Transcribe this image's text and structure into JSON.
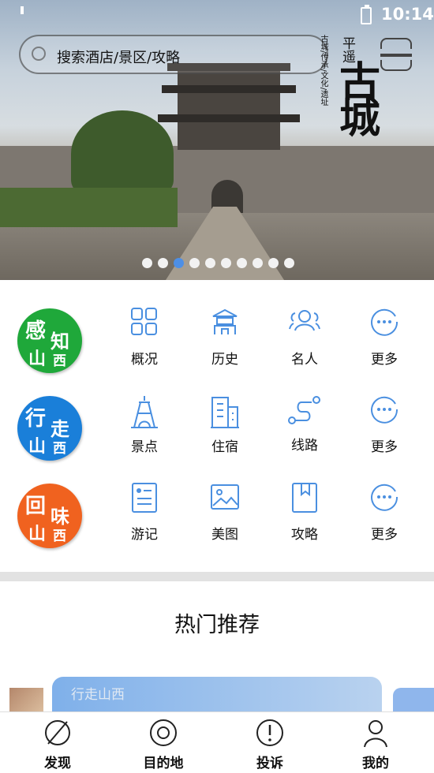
{
  "status_bar": {
    "time": "10:14"
  },
  "search": {
    "placeholder": "搜索酒店/景区/攻略"
  },
  "banner_logo": {
    "title": "平遥",
    "tagline": "古城/传承/文化/遗址",
    "big": "古城"
  },
  "carousel": {
    "count": 10,
    "active_index": 2
  },
  "categories": [
    {
      "badge": "感知山西",
      "badge_chars": [
        "感",
        "知",
        "山",
        "西"
      ],
      "badge_color": "#1fa83a",
      "items": [
        {
          "label": "概况",
          "icon": "grid-icon"
        },
        {
          "label": "历史",
          "icon": "pavilion-icon"
        },
        {
          "label": "名人",
          "icon": "people-icon"
        },
        {
          "label": "更多",
          "icon": "more-icon"
        }
      ]
    },
    {
      "badge": "行走山西",
      "badge_chars": [
        "行",
        "走",
        "山",
        "西"
      ],
      "badge_color": "#1a7fd9",
      "items": [
        {
          "label": "景点",
          "icon": "tower-icon"
        },
        {
          "label": "住宿",
          "icon": "building-icon"
        },
        {
          "label": "线路",
          "icon": "route-icon"
        },
        {
          "label": "更多",
          "icon": "more-icon"
        }
      ]
    },
    {
      "badge": "回味山西",
      "badge_chars": [
        "回",
        "味",
        "山",
        "西"
      ],
      "badge_color": "#f0621f",
      "items": [
        {
          "label": "游记",
          "icon": "note-icon"
        },
        {
          "label": "美图",
          "icon": "image-icon"
        },
        {
          "label": "攻略",
          "icon": "bookmark-icon"
        },
        {
          "label": "更多",
          "icon": "more-icon"
        }
      ]
    }
  ],
  "hot": {
    "title": "热门推荐",
    "card_text": "行走山西"
  },
  "tabs": [
    {
      "label": "发现",
      "icon": "compass-icon"
    },
    {
      "label": "目的地",
      "icon": "location-icon"
    },
    {
      "label": "投诉",
      "icon": "alert-icon"
    },
    {
      "label": "我的",
      "icon": "user-icon"
    }
  ],
  "colors": {
    "accent": "#4d8fe6",
    "icon_blue": "#4a8fe0"
  }
}
